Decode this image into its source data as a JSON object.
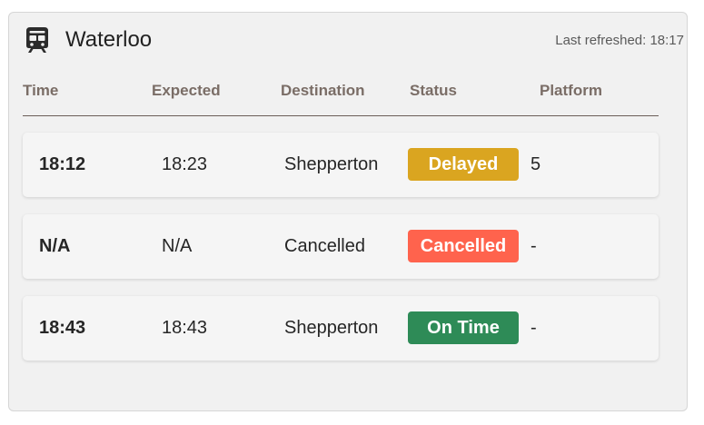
{
  "header": {
    "station": "Waterloo",
    "icon": "train-icon",
    "last_refreshed": "Last refreshed: 18:17"
  },
  "columns": [
    "Time",
    "Expected",
    "Destination",
    "Status",
    "Platform"
  ],
  "rows": [
    {
      "time": "18:12",
      "expected": "18:23",
      "destination": "Shepperton",
      "status": "Delayed",
      "status_color": "#daa520",
      "platform": "5"
    },
    {
      "time": "N/A",
      "expected": "N/A",
      "destination": "Cancelled",
      "status": "Cancelled",
      "status_color": "#ff634d",
      "platform": "-"
    },
    {
      "time": "18:43",
      "expected": "18:43",
      "destination": "Shepperton",
      "status": "On Time",
      "status_color": "#2e8b57",
      "platform": "-"
    }
  ]
}
